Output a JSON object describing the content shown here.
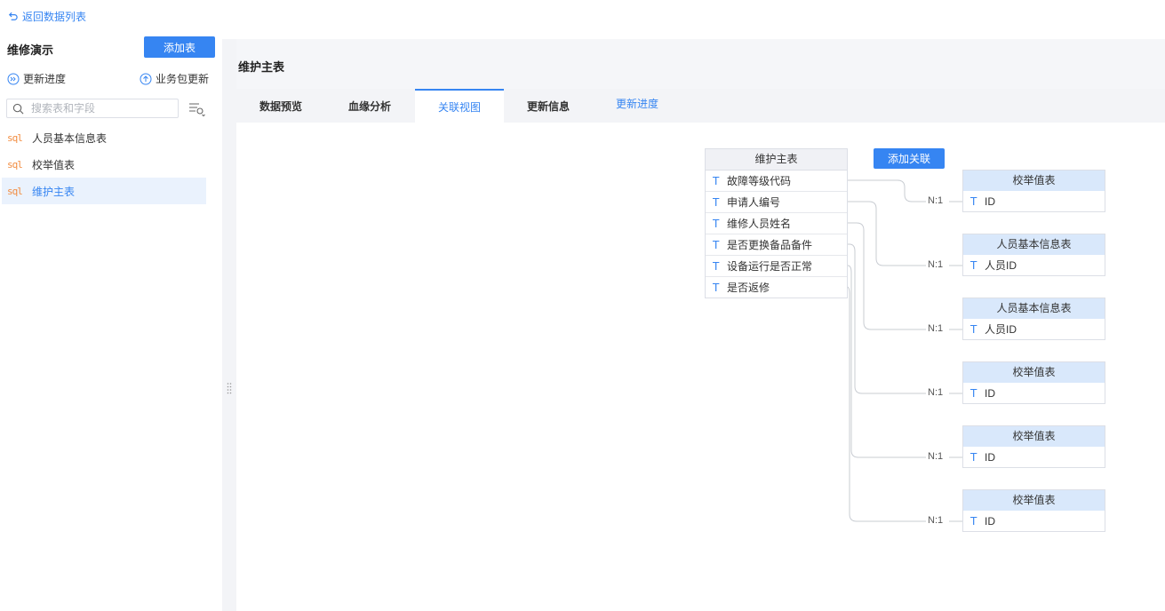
{
  "topbar": {
    "back_label": "返回数据列表"
  },
  "sidebar": {
    "package_title": "维修演示",
    "add_table_label": "添加表",
    "update_progress_label": "更新进度",
    "package_update_label": "业务包更新",
    "search_placeholder": "搜索表和字段",
    "tables": [
      {
        "icon": "sql",
        "label": "人员基本信息表"
      },
      {
        "icon": "sql",
        "label": "校举值表"
      },
      {
        "icon": "sql",
        "label": "维护主表"
      }
    ]
  },
  "main": {
    "title": "维护主表",
    "tabs": [
      {
        "label": "数据预览"
      },
      {
        "label": "血缘分析"
      },
      {
        "label": "关联视图"
      },
      {
        "label": "更新信息"
      },
      {
        "label": "更新进度"
      }
    ],
    "active_tab": "关联视图"
  },
  "diagram": {
    "add_relation_label": "添加关联",
    "main_table": {
      "name": "维护主表",
      "fields": [
        {
          "type": "T",
          "label": "故障等级代码"
        },
        {
          "type": "T",
          "label": "申请人编号"
        },
        {
          "type": "T",
          "label": "维修人员姓名"
        },
        {
          "type": "T",
          "label": "是否更换备品备件"
        },
        {
          "type": "T",
          "label": "设备运行是否正常"
        },
        {
          "type": "T",
          "label": "是否返修"
        }
      ]
    },
    "relations": [
      {
        "ratio": "N:1",
        "table": "校举值表",
        "field_type": "T",
        "field": "ID"
      },
      {
        "ratio": "N:1",
        "table": "人员基本信息表",
        "field_type": "T",
        "field": "人员ID"
      },
      {
        "ratio": "N:1",
        "table": "人员基本信息表",
        "field_type": "T",
        "field": "人员ID"
      },
      {
        "ratio": "N:1",
        "table": "校举值表",
        "field_type": "T",
        "field": "ID"
      },
      {
        "ratio": "N:1",
        "table": "校举值表",
        "field_type": "T",
        "field": "ID"
      },
      {
        "ratio": "N:1",
        "table": "校举值表",
        "field_type": "T",
        "field": "ID"
      }
    ]
  },
  "colors": {
    "accent": "#3685f2",
    "sql_icon": "#f28c40",
    "relation_header": "#d9e8fb"
  }
}
